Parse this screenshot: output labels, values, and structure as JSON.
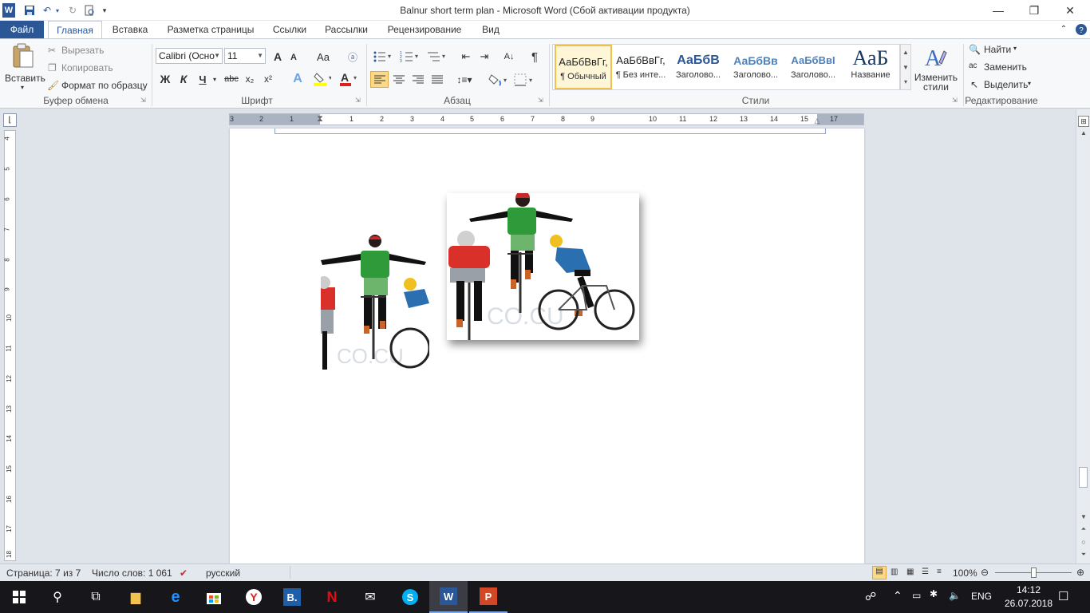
{
  "window": {
    "title": "Balnur short term plan  -  Microsoft Word (Сбой активации продукта)",
    "app_icon": "W",
    "minimize": "—",
    "restore": "❐",
    "close": "✕"
  },
  "quick_access": [
    "save-icon",
    "undo-icon",
    "redo-icon",
    "print-preview-icon",
    "customize-icon"
  ],
  "tabs": [
    {
      "label": "Файл"
    },
    {
      "label": "Главная"
    },
    {
      "label": "Вставка"
    },
    {
      "label": "Разметка страницы"
    },
    {
      "label": "Ссылки"
    },
    {
      "label": "Рассылки"
    },
    {
      "label": "Рецензирование"
    },
    {
      "label": "Вид"
    }
  ],
  "ribbon": {
    "clipboard": {
      "paste": "Вставить",
      "cut": "Вырезать",
      "copy": "Копировать",
      "format_painter": "Формат по образцу",
      "group_label": "Буфер обмена"
    },
    "font": {
      "font_name": "Calibri (Осно",
      "font_size": "11",
      "group_label": "Шрифт",
      "bold": "Ж",
      "italic": "К",
      "underline": "Ч",
      "strike": "abc",
      "subscript": "x₂",
      "superscript": "x²",
      "grow": "A",
      "shrink": "A",
      "case": "Aa"
    },
    "paragraph": {
      "group_label": "Абзац",
      "pilcrow": "¶"
    },
    "styles": {
      "group_label": "Стили",
      "items": [
        {
          "preview": "АаБбВвГг,",
          "name": "¶ Обычный"
        },
        {
          "preview": "АаБбВвГг,",
          "name": "¶ Без инте..."
        },
        {
          "preview": "АаБбВ",
          "name": "Заголово..."
        },
        {
          "preview": "АаБбВв",
          "name": "Заголово..."
        },
        {
          "preview": "АаБбВвІ",
          "name": "Заголово..."
        },
        {
          "preview": "АаБ",
          "name": "Название"
        }
      ],
      "change_styles": "Изменить стили"
    },
    "editing": {
      "group_label": "Редактирование",
      "find": "Найти",
      "replace": "Заменить",
      "select": "Выделить"
    }
  },
  "ruler": {
    "numbers": [
      "3",
      "2",
      "1",
      "1",
      "1",
      "2",
      "3",
      "4",
      "5",
      "6",
      "7",
      "8",
      "9",
      "10",
      "11",
      "12",
      "13",
      "14",
      "15",
      "16",
      "17"
    ],
    "vnumbers": [
      "4",
      "5",
      "6",
      "7",
      "8",
      "9",
      "10",
      "11",
      "12",
      "13",
      "14",
      "15",
      "16",
      "17",
      "18"
    ]
  },
  "document": {
    "images": [
      {
        "name": "cyclists-image-cropped",
        "watermark": "CO.CU"
      },
      {
        "name": "cyclists-image-framed",
        "watermark": "CO.CU"
      }
    ]
  },
  "status": {
    "page": "Страница: 7 из 7",
    "words": "Число слов: 1 061",
    "language": "русский",
    "zoom": "100%"
  },
  "taskbar": {
    "time": "14:12",
    "date": "26.07.2018",
    "language": "ENG"
  },
  "colors": {
    "accent": "#2b5797",
    "taskbar": "#17161a",
    "page": "#ffffff",
    "workspace": "#dfe3ea"
  }
}
